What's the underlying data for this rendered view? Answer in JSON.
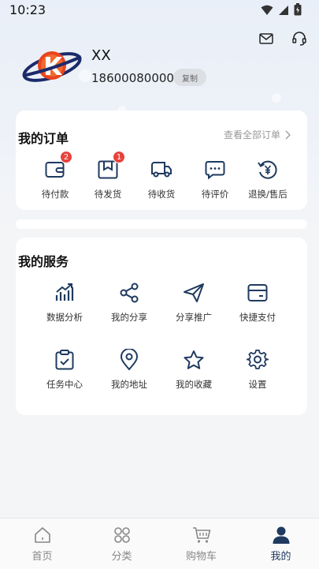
{
  "status_bar": {
    "time": "10:23"
  },
  "profile": {
    "name": "XX",
    "phone": "18600080000",
    "copy_label": "复制"
  },
  "orders": {
    "title": "我的订单",
    "view_all": "查看全部订单",
    "items": [
      {
        "label": "待付款",
        "icon": "wallet-icon",
        "badge": "2"
      },
      {
        "label": "待发货",
        "icon": "package-icon",
        "badge": "1"
      },
      {
        "label": "待收货",
        "icon": "truck-icon",
        "badge": ""
      },
      {
        "label": "待评价",
        "icon": "comment-icon",
        "badge": ""
      },
      {
        "label": "退换/售后",
        "icon": "refund-icon",
        "badge": ""
      }
    ]
  },
  "services": {
    "title": "我的服务",
    "items": [
      {
        "label": "数据分析",
        "icon": "chart-icon"
      },
      {
        "label": "我的分享",
        "icon": "share-icon"
      },
      {
        "label": "分享推广",
        "icon": "send-icon"
      },
      {
        "label": "快捷支付",
        "icon": "card-icon"
      },
      {
        "label": "任务中心",
        "icon": "clipboard-icon"
      },
      {
        "label": "我的地址",
        "icon": "location-icon"
      },
      {
        "label": "我的收藏",
        "icon": "star-icon"
      },
      {
        "label": "设置",
        "icon": "gear-icon"
      }
    ]
  },
  "tabbar": {
    "tabs": [
      {
        "label": "首页",
        "icon": "home-icon",
        "active": false
      },
      {
        "label": "分类",
        "icon": "category-icon",
        "active": false
      },
      {
        "label": "购物车",
        "icon": "cart-icon",
        "active": false
      },
      {
        "label": "我的",
        "icon": "user-icon",
        "active": true
      }
    ]
  },
  "colors": {
    "icon_primary": "#1f3a5f",
    "badge": "#e8423c",
    "background": "#f4f5f7",
    "card": "#ffffff"
  }
}
